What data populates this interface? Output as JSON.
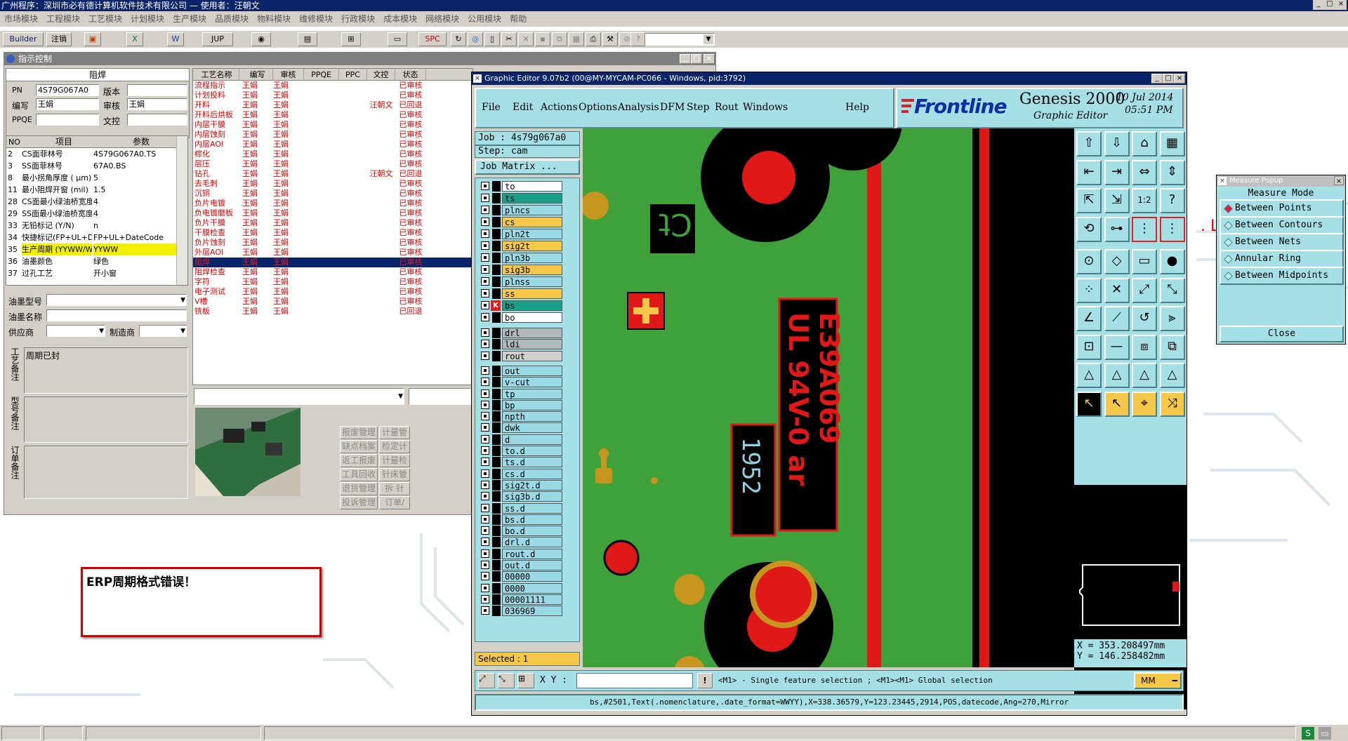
{
  "app": {
    "title": "广州程序：深圳市必有德计算机软件技术有限公司 — 使用者：汪朝文",
    "menu": [
      "市场模块",
      "工程模块",
      "工艺模块",
      "计划模块",
      "生产模块",
      "品质模块",
      "物料模块",
      "维修模块",
      "行政模块",
      "成本模块",
      "网络模块",
      "公用模块",
      "帮助"
    ],
    "toolbar": {
      "builder": "Builder",
      "logout": "注销",
      "jup": "JUP",
      "spc": "SPC"
    }
  },
  "left": {
    "title": "指示控制",
    "section": "阻焊",
    "pn_label": "PN",
    "pn": "4S79G067A0",
    "ver_label": "版本",
    "editor_label": "编写",
    "editor": "王娟",
    "reviewer_label": "审核",
    "reviewer": "王娟",
    "ppqe_label": "PPQE",
    "doc_label": "文控",
    "params_head": [
      "NO",
      "项目",
      "参数"
    ],
    "params": [
      [
        "2",
        "CS面菲林号",
        "4S79G067A0.TS"
      ],
      [
        "3",
        "SS面菲林号",
        "67A0.BS"
      ],
      [
        "8",
        "最小拐角厚度 ( μm)",
        "5"
      ],
      [
        "11",
        "最小阻焊开窗 (mil)",
        "1.5"
      ],
      [
        "28",
        "CS面最小绿油桥宽度 (m",
        "4"
      ],
      [
        "29",
        "SS面最小绿油桥宽度 (m",
        "4"
      ],
      [
        "33",
        "无铅标记 (Y/N)",
        "n"
      ],
      [
        "34",
        "快捷标记(FP+UL+DateCo",
        "FP+UL+DateCode"
      ],
      [
        "35",
        "生产周期 (YYWW/WWYY)",
        "YYWW"
      ],
      [
        "36",
        "油墨颜色",
        "绿色"
      ],
      [
        "37",
        "过孔工艺",
        "开小窗"
      ]
    ],
    "ink_type_label": "油墨型号",
    "ink_name_label": "油墨名称",
    "supplier_label": "供应商",
    "maker_label": "制造商",
    "remark1_label": "工艺备注",
    "remark1": "周期已封",
    "remark2_label": "型号备注",
    "remark3_label": "订单备注",
    "proc_head": [
      "工艺名称",
      "编写",
      "审核",
      "PPQE",
      "PPC",
      "文控",
      "状态"
    ],
    "procs": [
      [
        "流程指示",
        "王娟",
        "王娟",
        "",
        "",
        "",
        "已审核"
      ],
      [
        "计划投料",
        "王娟",
        "王娟",
        "",
        "",
        "",
        "已审核"
      ],
      [
        "开料",
        "王娟",
        "王娟",
        "",
        "",
        "汪朝文",
        "已回退"
      ],
      [
        "开料后烘板",
        "王娟",
        "王娟",
        "",
        "",
        "",
        "已审核"
      ],
      [
        "内层干膜",
        "王娟",
        "王娟",
        "",
        "",
        "",
        "已审核"
      ],
      [
        "内层蚀刻",
        "王娟",
        "王娟",
        "",
        "",
        "",
        "已审核"
      ],
      [
        "内层AOI",
        "王娟",
        "王娟",
        "",
        "",
        "",
        "已审核"
      ],
      [
        "棕化",
        "王娟",
        "王娟",
        "",
        "",
        "",
        "已审核"
      ],
      [
        "层压",
        "王娟",
        "王娟",
        "",
        "",
        "",
        "已审核"
      ],
      [
        "钻孔",
        "王娟",
        "王娟",
        "",
        "",
        "汪朝文",
        "已回退"
      ],
      [
        "去毛刺",
        "王娟",
        "王娟",
        "",
        "",
        "",
        "已审核"
      ],
      [
        "沉铜",
        "王娟",
        "王娟",
        "",
        "",
        "",
        "已审核"
      ],
      [
        "负片电镀",
        "王娟",
        "王娟",
        "",
        "",
        "",
        "已审核"
      ],
      [
        "负电镀磨板",
        "王娟",
        "王娟",
        "",
        "",
        "",
        "已审核"
      ],
      [
        "负片干膜",
        "王娟",
        "王娟",
        "",
        "",
        "",
        "已审核"
      ],
      [
        "干膜检查",
        "王娟",
        "王娟",
        "",
        "",
        "",
        "已审核"
      ],
      [
        "负片蚀刻",
        "王娟",
        "王娟",
        "",
        "",
        "",
        "已审核"
      ],
      [
        "外层AOI",
        "王娟",
        "王娟",
        "",
        "",
        "",
        "已审核"
      ],
      [
        "阻焊",
        "王娟",
        "王娟",
        "",
        "",
        "",
        "已审核"
      ],
      [
        "阻焊检查",
        "王娟",
        "王娟",
        "",
        "",
        "",
        "已审核"
      ],
      [
        "字符",
        "王娟",
        "王娟",
        "",
        "",
        "",
        "已审核"
      ],
      [
        "电子测试",
        "王娟",
        "王娟",
        "",
        "",
        "",
        "已审核"
      ],
      [
        "V槽",
        "王娟",
        "王娟",
        "",
        "",
        "",
        "已审核"
      ],
      [
        "铣板",
        "王娟",
        "王娟",
        "",
        "",
        "",
        "已回退"
      ]
    ],
    "side_buttons": [
      [
        "报废管理",
        "计量管"
      ],
      [
        "缺点档案",
        "检定计"
      ],
      [
        "返工报废",
        "计量检"
      ],
      [
        "工具回收",
        "针床管"
      ],
      [
        "退货管理",
        "拆 针"
      ],
      [
        "投诉管理",
        "订单/"
      ]
    ]
  },
  "erp": {
    "message": "ERP周期格式错误！"
  },
  "genesis": {
    "title": "Graphic Editor 9.07b2 (00@MY-MYCAM-PC066 - Windows, pid:3792)",
    "menu": [
      "File",
      "Edit",
      "Actions",
      "Options",
      "Analysis",
      "DFM",
      "Step",
      "Rout",
      "Windows",
      "Help"
    ],
    "brand": "Frontline",
    "product": "Genesis 2000",
    "subtitle": "Graphic Editor",
    "date": "10 Jul 2014",
    "time": "05:51 PM",
    "job": "Job : 4s79g067a0",
    "step": "Step: cam",
    "matrix": "Job Matrix ...",
    "layers": [
      {
        "n": "to",
        "c": "#ffffff"
      },
      {
        "n": "ts",
        "c": "#1aa08a"
      },
      {
        "n": "plncs",
        "c": "#9ad9e6"
      },
      {
        "n": "cs",
        "c": "#f5c84a"
      },
      {
        "n": "pln2t",
        "c": "#9ad9e6"
      },
      {
        "n": "sig2t",
        "c": "#f5c84a"
      },
      {
        "n": "pln3b",
        "c": "#9ad9e6"
      },
      {
        "n": "sig3b",
        "c": "#f5c84a"
      },
      {
        "n": "plnss",
        "c": "#9ad9e6"
      },
      {
        "n": "ss",
        "c": "#f5c84a"
      },
      {
        "n": "bs",
        "c": "#1aa08a"
      },
      {
        "n": "bo",
        "c": "#ffffff"
      },
      {
        "n": "drl",
        "c": "#b0b8bc"
      },
      {
        "n": "ldi",
        "c": "#b0b8bc"
      },
      {
        "n": "rout",
        "c": "#d0d0d0"
      },
      {
        "n": "out",
        "c": "#9ad9e6"
      },
      {
        "n": "v-cut",
        "c": "#9ad9e6"
      },
      {
        "n": "tp",
        "c": "#9ad9e6"
      },
      {
        "n": "bp",
        "c": "#9ad9e6"
      },
      {
        "n": "npth",
        "c": "#9ad9e6"
      },
      {
        "n": "dwk",
        "c": "#9ad9e6"
      },
      {
        "n": "d",
        "c": "#9ad9e6"
      },
      {
        "n": "to.d",
        "c": "#9ad9e6"
      },
      {
        "n": "ts.d",
        "c": "#9ad9e6"
      },
      {
        "n": "cs.d",
        "c": "#9ad9e6"
      },
      {
        "n": "sig2t.d",
        "c": "#9ad9e6"
      },
      {
        "n": "sig3b.d",
        "c": "#9ad9e6"
      },
      {
        "n": "ss.d",
        "c": "#9ad9e6"
      },
      {
        "n": "bs.d",
        "c": "#9ad9e6"
      },
      {
        "n": "bo.d",
        "c": "#9ad9e6"
      },
      {
        "n": "drl.d",
        "c": "#9ad9e6"
      },
      {
        "n": "rout.d",
        "c": "#9ad9e6"
      },
      {
        "n": "out.d",
        "c": "#9ad9e6"
      },
      {
        "n": "00000",
        "c": "#9ad9e6"
      },
      {
        "n": "0000",
        "c": "#9ad9e6"
      },
      {
        "n": "00001111",
        "c": "#9ad9e6"
      },
      {
        "n": "036969",
        "c": "#9ad9e6"
      }
    ],
    "selected": "Selected : 1",
    "x": "X = 353.208497mm",
    "y": "Y = 146.258482mm",
    "xy_label": "X Y :",
    "hint": "<M1> - Single feature selection ; <M1><M1> Global selection",
    "units": "MM",
    "status": "bs,#2501,Text(.nomenclature,.date_format=WWYY),X=338.36579,Y=123.23445,2914,POS,datecode,Ang=270,Mirror"
  },
  "measure": {
    "title": "Measure Popup",
    "mode": "Measure Mode",
    "options": [
      "Between Points",
      "Between Contours",
      "Between Nets",
      "Annular Ring",
      "Between Midpoints"
    ],
    "close": "Close"
  }
}
